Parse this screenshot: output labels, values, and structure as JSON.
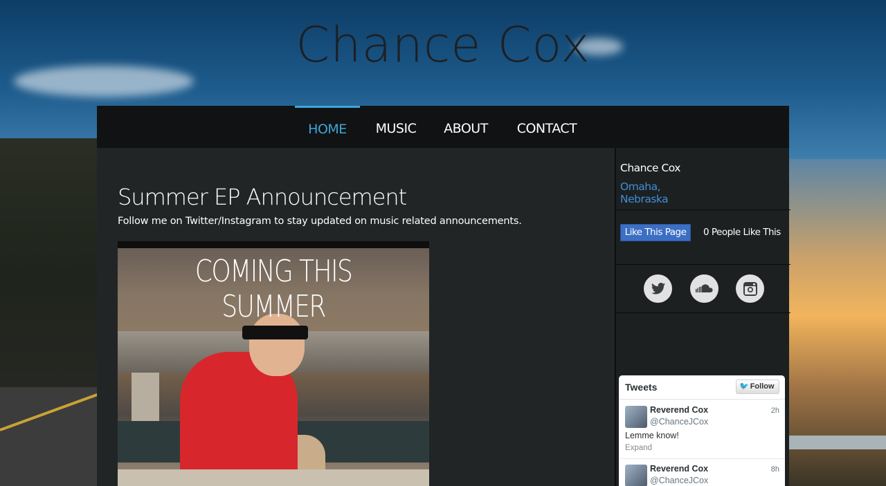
{
  "site": {
    "title": "Chance Cox"
  },
  "nav": {
    "items": [
      {
        "label": "HOME",
        "active": true
      },
      {
        "label": "MUSIC",
        "active": false
      },
      {
        "label": "ABOUT",
        "active": false
      },
      {
        "label": "CONTACT",
        "active": false
      }
    ],
    "active_color": "#3fa6da"
  },
  "post": {
    "title": "Summer EP Announcement",
    "text": "Follow me on Twitter/Instagram to stay updated on music related announcements.",
    "image_headline": "COMING THIS SUMMER"
  },
  "sidebar": {
    "name": "Chance Cox",
    "location": "Omaha, Nebraska",
    "like_button": "Like This Page",
    "like_count": "0 People Like This",
    "social": [
      {
        "icon": "twitter-icon"
      },
      {
        "icon": "soundcloud-icon"
      },
      {
        "icon": "instagram-icon"
      }
    ]
  },
  "tweets": {
    "title": "Tweets",
    "follow_label": "Follow",
    "items": [
      {
        "name": "Reverend Cox",
        "handle": "@ChanceJCox",
        "time": "2h",
        "text": "Lemme know!",
        "expand": "Expand"
      },
      {
        "name": "Reverend Cox",
        "handle": "@ChanceJCox",
        "time": "8h",
        "text": "",
        "expand": ""
      }
    ]
  }
}
